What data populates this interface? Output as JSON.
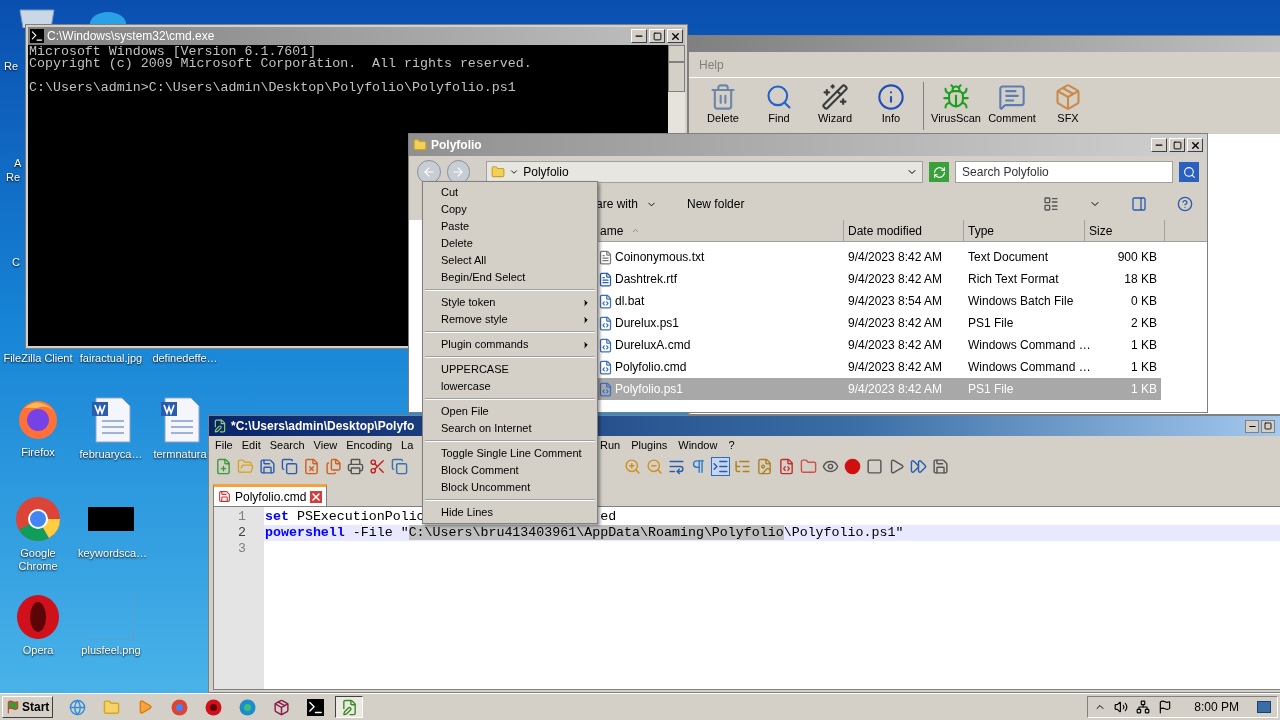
{
  "desktop": {
    "icons": [
      {
        "label": "Re",
        "kind": "edge"
      },
      {
        "label": "A",
        "kind": "edge"
      },
      {
        "label": "Re",
        "kind": "edge"
      },
      {
        "label": "C",
        "kind": "edge"
      },
      {
        "label": "FileZilla Client",
        "kind": "covered"
      },
      {
        "label": "fairactual.jpg",
        "kind": "covered"
      },
      {
        "label": "definedeffe…",
        "kind": "covered"
      },
      {
        "label": "Firefox",
        "kind": "firefox"
      },
      {
        "label": "februaryca…",
        "kind": "word"
      },
      {
        "label": "termnatura",
        "kind": "word"
      },
      {
        "label": "Google Chrome",
        "kind": "chrome"
      },
      {
        "label": "keywordsca…",
        "kind": "dark-image"
      },
      {
        "label": "Opera",
        "kind": "opera"
      },
      {
        "label": "plusfeel.png",
        "kind": "blank-image"
      }
    ]
  },
  "cmd": {
    "title": "C:\\Windows\\system32\\cmd.exe",
    "blocks": [
      [
        "Microsoft Windows [Version 6.1.7601]",
        "Copyright (c) 2009 Microsoft Corporation.  All rights reserved."
      ],
      [
        "C:\\Users\\admin>C:\\Users\\admin\\Desktop\\Polyfolio\\Polyfolio.ps1"
      ]
    ]
  },
  "winrar": {
    "menu": [
      "Help"
    ],
    "tools": [
      {
        "label": "Delete",
        "kind": "trash"
      },
      {
        "label": "Find",
        "kind": "find"
      },
      {
        "label": "Wizard",
        "kind": "wizard"
      },
      {
        "label": "Info",
        "kind": "info"
      },
      {
        "label": "VirusScan",
        "kind": "scan"
      },
      {
        "label": "Comment",
        "kind": "comment"
      },
      {
        "label": "SFX",
        "kind": "sfx"
      }
    ]
  },
  "explorer": {
    "title": "Polyfolio",
    "address": "Polyfolio",
    "search": {
      "placeholder": "Search Polyfolio"
    },
    "toolbar": [
      "are with",
      "New folder"
    ],
    "columns": [
      "ame",
      "Date modified",
      "Type",
      "Size"
    ],
    "files": [
      {
        "name": "Coinonymous.txt",
        "date": "9/4/2023 8:42 AM",
        "type": "Text Document",
        "size": "900 KB",
        "kind": "text",
        "selected": false
      },
      {
        "name": "Dashtrek.rtf",
        "date": "9/4/2023 8:42 AM",
        "type": "Rich Text Format",
        "size": "18 KB",
        "kind": "rtf",
        "selected": false
      },
      {
        "name": "dl.bat",
        "date": "9/4/2023 8:54 AM",
        "type": "Windows Batch File",
        "size": "0 KB",
        "kind": "script",
        "selected": false
      },
      {
        "name": "Durelux.ps1",
        "date": "9/4/2023 8:42 AM",
        "type": "PS1 File",
        "size": "2 KB",
        "kind": "script",
        "selected": false
      },
      {
        "name": "DureluxA.cmd",
        "date": "9/4/2023 8:42 AM",
        "type": "Windows Command …",
        "size": "1 KB",
        "kind": "script",
        "selected": false
      },
      {
        "name": "Polyfolio.cmd",
        "date": "9/4/2023 8:42 AM",
        "type": "Windows Command …",
        "size": "1 KB",
        "kind": "script",
        "selected": false
      },
      {
        "name": "Polyfolio.ps1",
        "date": "9/4/2023 8:42 AM",
        "type": "PS1 File",
        "size": "1 KB",
        "kind": "script",
        "selected": true
      }
    ]
  },
  "notepad": {
    "title": "*C:\\Users\\admin\\Desktop\\Polyfo",
    "menu_left": [
      "File",
      "Edit",
      "Search",
      "View",
      "Encoding",
      "La"
    ],
    "menu_right": [
      "Run",
      "Plugins",
      "Window",
      "?"
    ],
    "tab": {
      "label": "Polyfolio.cmd",
      "selected": true
    },
    "lines": [
      {
        "number": "1",
        "current": false,
        "segments": [
          {
            "kind": "keyword",
            "text": "set"
          },
          {
            "kind": "plain",
            "text": " PSExecutionPolic"
          },
          {
            "kind": "tail",
            "text": "ed"
          }
        ]
      },
      {
        "number": "2",
        "current": true,
        "segments": [
          {
            "kind": "keyword",
            "text": "powershell"
          },
          {
            "kind": "plain",
            "text": " -File \""
          },
          {
            "kind": "selected",
            "text": "C:\\Users\\bru413403961\\AppData\\Roaming\\Polyfolio"
          },
          {
            "kind": "plain",
            "text": "\\Polyfolio.ps1\""
          }
        ]
      },
      {
        "number": "3",
        "current": false
      }
    ]
  },
  "context_menu": {
    "items": [
      {
        "kind": "item",
        "label": "Cut"
      },
      {
        "kind": "item",
        "label": "Copy"
      },
      {
        "kind": "item",
        "label": "Paste"
      },
      {
        "kind": "item",
        "label": "Delete"
      },
      {
        "kind": "item",
        "label": "Select All"
      },
      {
        "kind": "item",
        "label": "Begin/End Select"
      },
      {
        "kind": "separator"
      },
      {
        "kind": "submenu",
        "label": "Style token"
      },
      {
        "kind": "submenu",
        "label": "Remove style"
      },
      {
        "kind": "separator"
      },
      {
        "kind": "submenu",
        "label": "Plugin commands"
      },
      {
        "kind": "separator"
      },
      {
        "kind": "item",
        "label": "UPPERCASE"
      },
      {
        "kind": "item",
        "label": "lowercase"
      },
      {
        "kind": "separator"
      },
      {
        "kind": "item",
        "label": "Open File"
      },
      {
        "kind": "item",
        "label": "Search on Internet"
      },
      {
        "kind": "separator"
      },
      {
        "kind": "item",
        "label": "Toggle Single Line Comment"
      },
      {
        "kind": "item",
        "label": "Block Comment"
      },
      {
        "kind": "item",
        "label": "Block Uncomment"
      },
      {
        "kind": "separator"
      },
      {
        "kind": "item",
        "label": "Hide Lines"
      }
    ]
  },
  "taskbar": {
    "start": "Start",
    "apps": [
      {
        "kind": "ie",
        "active": false
      },
      {
        "kind": "folder",
        "active": false
      },
      {
        "kind": "media",
        "active": false
      },
      {
        "kind": "chrome",
        "active": false
      },
      {
        "kind": "opera",
        "active": false
      },
      {
        "kind": "edge",
        "active": false
      },
      {
        "kind": "winrar",
        "active": false
      },
      {
        "kind": "cmd",
        "active": false
      },
      {
        "kind": "notepad",
        "active": true
      }
    ],
    "clock": "8:00 PM"
  }
}
